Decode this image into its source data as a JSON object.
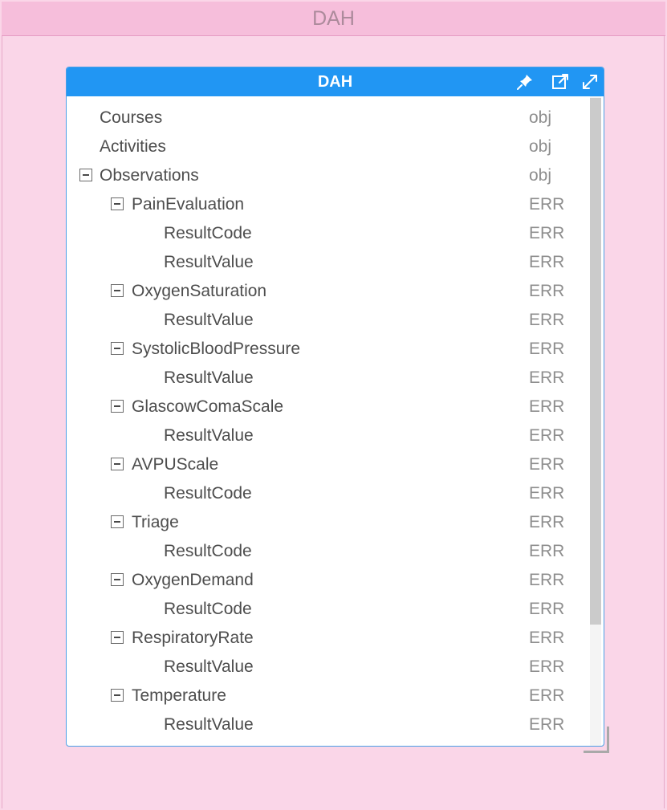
{
  "window": {
    "title": "DAH"
  },
  "panel": {
    "title": "DAH",
    "icons": {
      "pin": "pin-icon",
      "popout": "popout-icon",
      "expand": "expand-icon"
    }
  },
  "colors": {
    "background": "#fad6e8",
    "outer_title_bar": "#f6bedb",
    "panel_header": "#2196f3",
    "panel_border": "#4b9fe6"
  },
  "tree": [
    {
      "label": "Courses",
      "value": "obj"
    },
    {
      "label": "Activities",
      "value": "obj"
    },
    {
      "label": "Observations",
      "value": "obj"
    },
    {
      "label": "PainEvaluation",
      "value": "ERR"
    },
    {
      "label": "ResultCode",
      "value": "ERR"
    },
    {
      "label": "ResultValue",
      "value": "ERR"
    },
    {
      "label": "OxygenSaturation",
      "value": "ERR"
    },
    {
      "label": "ResultValue",
      "value": "ERR"
    },
    {
      "label": "SystolicBloodPressure",
      "value": "ERR"
    },
    {
      "label": "ResultValue",
      "value": "ERR"
    },
    {
      "label": "GlascowComaScale",
      "value": "ERR"
    },
    {
      "label": "ResultValue",
      "value": "ERR"
    },
    {
      "label": "AVPUScale",
      "value": "ERR"
    },
    {
      "label": "ResultCode",
      "value": "ERR"
    },
    {
      "label": "Triage",
      "value": "ERR"
    },
    {
      "label": "ResultCode",
      "value": "ERR"
    },
    {
      "label": "OxygenDemand",
      "value": "ERR"
    },
    {
      "label": "ResultCode",
      "value": "ERR"
    },
    {
      "label": "RespiratoryRate",
      "value": "ERR"
    },
    {
      "label": "ResultValue",
      "value": "ERR"
    },
    {
      "label": "Temperature",
      "value": "ERR"
    },
    {
      "label": "ResultValue",
      "value": "ERR"
    }
  ]
}
